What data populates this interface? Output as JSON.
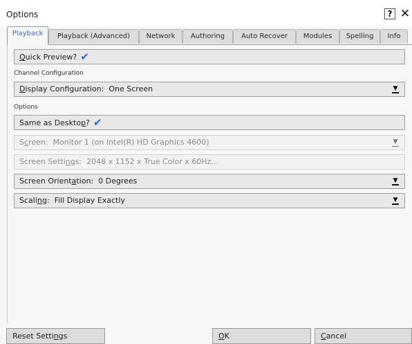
{
  "window": {
    "title": "Options"
  },
  "titlebar": {
    "help_label": "?",
    "close_label": "✕"
  },
  "tabs": [
    {
      "label": "Playback",
      "active": true
    },
    {
      "label": "Playback (Advanced)",
      "active": false
    },
    {
      "label": "Network",
      "active": false
    },
    {
      "label": "Authoring",
      "active": false
    },
    {
      "label": "Auto Recover",
      "active": false
    },
    {
      "label": "Modules",
      "active": false
    },
    {
      "label": "Spelling",
      "active": false
    },
    {
      "label": "Info",
      "active": false
    }
  ],
  "playback": {
    "quick_preview": {
      "pre": "",
      "key": "Q",
      "post": "uick Preview?",
      "checked": true
    },
    "channel_section": "Channel Configuration",
    "display_config": {
      "pre": "",
      "key": "D",
      "post": "isplay Configuration:",
      "value": "One Screen"
    },
    "options_section": "Options",
    "same_as_desktop": {
      "pre": "Same as Deskto",
      "key": "p",
      "post": "?",
      "checked": true
    },
    "screen": {
      "pre": "S",
      "key": "c",
      "post": "reen:",
      "value": "Monitor 1 (on Intel(R) HD Graphics 4600)"
    },
    "screen_settings": {
      "pre": "Screen Setti",
      "key": "n",
      "post": "gs:",
      "value": "2048 x 1152 x True Color x 60Hz..."
    },
    "orientation": {
      "pre": "Screen Orient",
      "key": "a",
      "post": "tion:",
      "value": "0 Degrees"
    },
    "scaling": {
      "pre": "Scali",
      "key": "n",
      "post": "g:",
      "value": "Fill Display Exactly"
    }
  },
  "footer": {
    "reset_pre": "Reset Setti",
    "reset_key": "n",
    "reset_post": "gs",
    "ok_pre": "",
    "ok_key": "O",
    "ok_post": "K",
    "cancel_pre": "",
    "cancel_key": "C",
    "cancel_post": "ancel"
  },
  "icons": {
    "check": "checkmark-icon",
    "dropdown": "dropdown-arrow-icon"
  },
  "colors": {
    "accent": "#2a6ad2",
    "active_tab_text": "#3a6cc0"
  }
}
